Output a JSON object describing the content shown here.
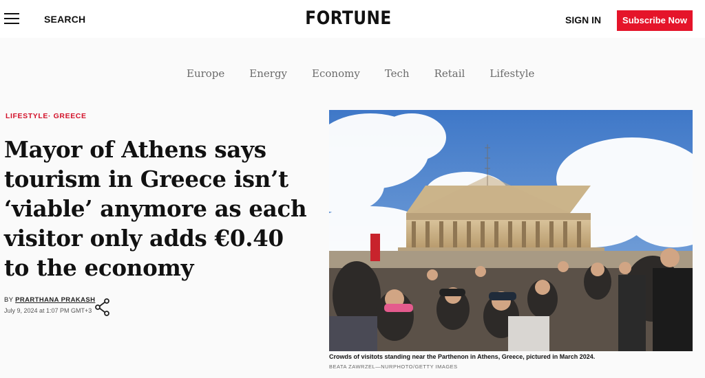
{
  "header": {
    "search_label": "SEARCH",
    "logo": "FORTUNE",
    "signin_label": "SIGN IN",
    "subscribe_label": "Subscribe Now",
    "accent": "#e5142a"
  },
  "nav": {
    "items": [
      {
        "label": "Europe"
      },
      {
        "label": "Energy"
      },
      {
        "label": "Economy"
      },
      {
        "label": "Tech"
      },
      {
        "label": "Retail"
      },
      {
        "label": "Lifestyle"
      }
    ]
  },
  "article": {
    "kicker_section": "LIFESTYLE",
    "kicker_separator": "·",
    "kicker_topic": "GREECE",
    "headline": "Mayor of Athens says tourism in Greece isn’t ‘viable’ anymore as each visitor only adds €0.40 to the economy",
    "by_prefix": "BY",
    "author": "PRARTHANA PRAKASH",
    "date": "July 9, 2024 at 1:07 PM GMT+3",
    "share_icon": "share-icon"
  },
  "image": {
    "caption": "Crowds of visitots standing near the Parthenon in Athens, Greece, pictured in March 2024.",
    "credit": "BEATA ZAWRZEL—NURPHOTO/GETTY IMAGES"
  }
}
